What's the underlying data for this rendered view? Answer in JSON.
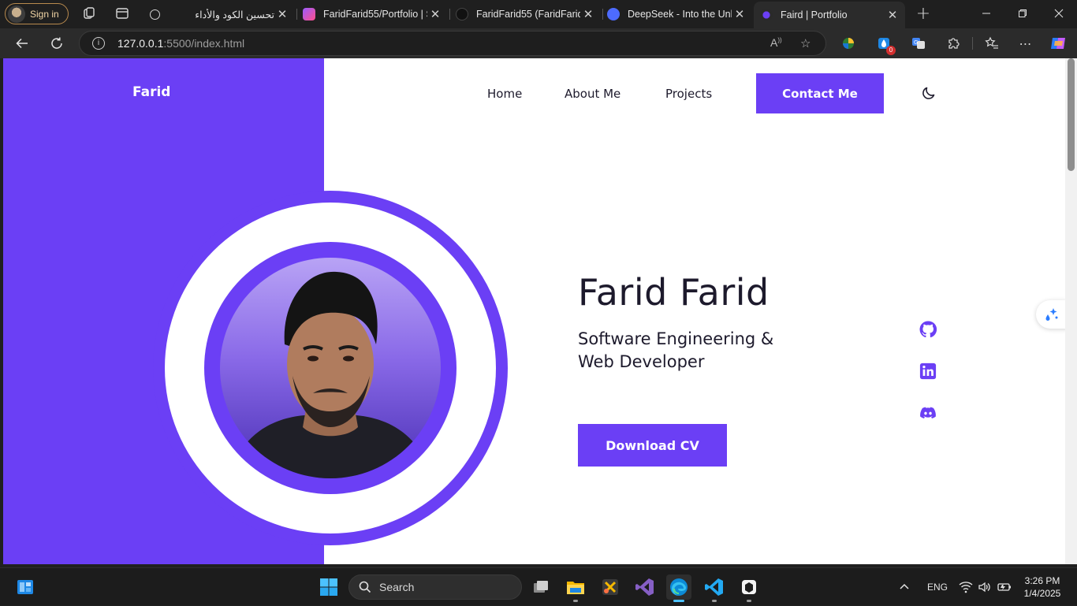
{
  "browser": {
    "profile_label": "Sign in",
    "tabs": [
      {
        "title": "تحسين الكود والأداء",
        "active": false
      },
      {
        "title": "FaridFarid55/Portfolio | Si",
        "active": false
      },
      {
        "title": "FaridFarid55 (FaridFarid)",
        "active": false
      },
      {
        "title": "DeepSeek - Into the Unkn",
        "active": false
      },
      {
        "title": "Faird | Portfolio",
        "active": true
      }
    ],
    "url_host": "127.0.0.1",
    "url_path": ":5500/index.html",
    "extension_badge": "0"
  },
  "site": {
    "logo": "Farid",
    "nav": {
      "home": "Home",
      "about": "About Me",
      "projects": "Projects",
      "contact": "Contact Me"
    },
    "hero": {
      "name": "Farid Farid",
      "role_line1": "Software Engineering &",
      "role_line2": "Web Developer",
      "cta": "Download CV"
    },
    "accent_color": "#6b3ff5",
    "text_color": "#1d1a2c"
  },
  "taskbar": {
    "search_label": "Search",
    "language": "ENG",
    "time": "3:26 PM",
    "date": "1/4/2025"
  }
}
